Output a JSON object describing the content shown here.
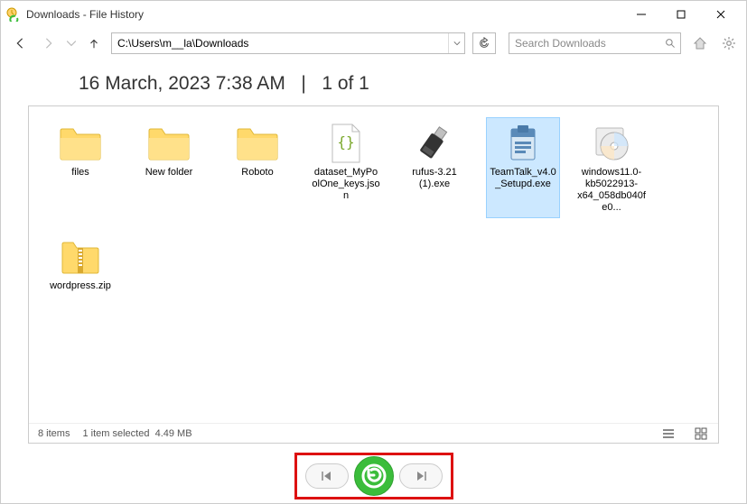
{
  "window": {
    "title": "Downloads - File History"
  },
  "nav": {
    "address": "C:\\Users\\m__la\\Downloads",
    "search_placeholder": "Search Downloads"
  },
  "header": {
    "date": "16 March, 2023 7:38 AM",
    "sep": "|",
    "page": "1 of 1"
  },
  "items": [
    {
      "name": "files",
      "type": "folder",
      "selected": false
    },
    {
      "name": "New folder",
      "type": "folder",
      "selected": false
    },
    {
      "name": "Roboto",
      "type": "folder",
      "selected": false
    },
    {
      "name": "dataset_MyPoolOne_keys.json",
      "type": "json",
      "selected": false
    },
    {
      "name": "rufus-3.21 (1).exe",
      "type": "usb",
      "selected": false
    },
    {
      "name": "TeamTalk_v4.0_Setupd.exe",
      "type": "installer",
      "selected": true
    },
    {
      "name": "windows11.0-kb5022913-x64_058db040fe0...",
      "type": "disc",
      "selected": false
    },
    {
      "name": "wordpress.zip",
      "type": "zip",
      "selected": false
    }
  ],
  "status": {
    "count": "8 items",
    "selection": "1 item selected",
    "size": "4.49 MB"
  }
}
